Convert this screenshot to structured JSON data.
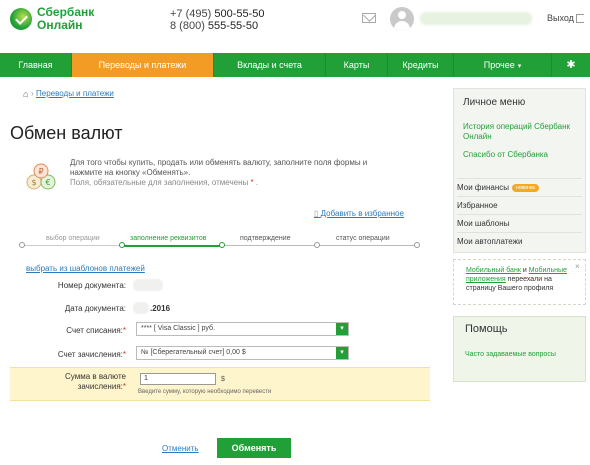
{
  "brand": {
    "name_line1": "Сбербанк",
    "name_line2": "Онлайн",
    "color": "#21a038",
    "accent": "#f39c25"
  },
  "header": {
    "phone1_prefix": "+7 (495) ",
    "phone1_main": "500-55-50",
    "phone2_prefix": "8 (800) ",
    "phone2_main": "555-55-50",
    "logout": "Выход",
    "icons": [
      "mail-icon",
      "avatar",
      "logout-icon"
    ]
  },
  "nav": {
    "items": [
      {
        "label": "Главная"
      },
      {
        "label": "Переводы и платежи"
      },
      {
        "label": "Вклады и счета"
      },
      {
        "label": "Карты"
      },
      {
        "label": "Кредиты"
      },
      {
        "label": "Прочее"
      }
    ],
    "active_index": 1,
    "settings_icon": "gear-icon"
  },
  "breadcrumb": {
    "link": "Переводы и платежи"
  },
  "page": {
    "title": "Обмен валют",
    "info_text": "Для того чтобы купить, продать или обменять валюту, заполните поля формы и нажмите на кнопку «Обменять».",
    "required_note": "Поля, обязательные для заполнения, отмечены",
    "required_star": "*",
    "required_end": ".",
    "favorite": "Добавить в избранное"
  },
  "steps": [
    {
      "label": "выбор операции",
      "state": "done"
    },
    {
      "label": "заполнение реквизитов",
      "state": "active"
    },
    {
      "label": "подтверждение",
      "state": "pending"
    },
    {
      "label": "статус операции",
      "state": "pending"
    }
  ],
  "form": {
    "templates_link": "выбрать из шаблонов платежей",
    "doc_number_label": "Номер документа:",
    "doc_date_label": "Дата документа:",
    "doc_date_value": ".2016",
    "debit_label": "Счет списания:",
    "debit_value": "****          [ Visa Classic ]                    руб.",
    "credit_label": "Счет зачисления:",
    "credit_value": "№                       [Сберегательный счет] 0,00   $",
    "amount_label_line1": "Сумма в валюте",
    "amount_label_line2": "зачисления:",
    "amount_value": "1",
    "amount_currency": "$",
    "amount_hint": "Введите сумму, которую необходимо перевести",
    "cancel": "Отменить",
    "submit": "Обменять"
  },
  "sidebar": {
    "menu_title": "Личное меню",
    "links": [
      "История операций Сбербанк Онлайн",
      "Спасибо от Сбербанка"
    ],
    "items": [
      {
        "label": "Мои финансы",
        "badge": "новинка"
      },
      {
        "label": "Избранное"
      },
      {
        "label": "Мои шаблоны"
      },
      {
        "label": "Мои автоплатежи"
      }
    ],
    "notice_part1": "Мобильный банк",
    "notice_part2": " и ",
    "notice_part3": "Мобильные приложения",
    "notice_part4": " переехали на страницу Вашего профиля",
    "notice_close": "×",
    "help_title": "Помощь",
    "help_link": "Часто задаваемые вопросы"
  }
}
